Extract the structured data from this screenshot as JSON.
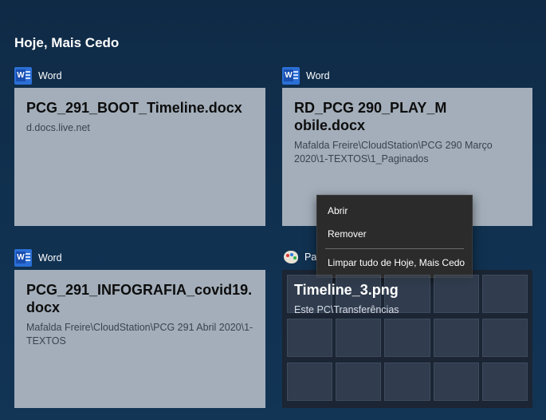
{
  "section_title": "Hoje, Mais Cedo",
  "cards": [
    {
      "app": "Word",
      "title": "PCG_291_BOOT_Timeline.docx",
      "path": "d.docs.live.net"
    },
    {
      "app": "Word",
      "title": "RD_PCG 290_PLAY_Mobile.docx",
      "path": "Mafalda Freire\\CloudStation\\PCG 290 Março 2020\\1-TEXTOS\\1_Paginados"
    },
    {
      "app": "Word",
      "title": "PCG_291_INFOGRAFIA_covid19.docx",
      "path": "Mafalda Freire\\CloudStation\\PCG 291 Abril 2020\\1-TEXTOS"
    },
    {
      "app": "Pa",
      "title": "Timeline_3.png",
      "path": "Este PC\\Transferências"
    }
  ],
  "context_menu": {
    "items": [
      "Abrir",
      "Remover",
      "Limpar tudo de Hoje, Mais Cedo"
    ]
  },
  "colors": {
    "background": "#10304f",
    "card": "#a3aeba",
    "word_icon": "#2b6fd6",
    "menu": "#2b2b2b"
  }
}
